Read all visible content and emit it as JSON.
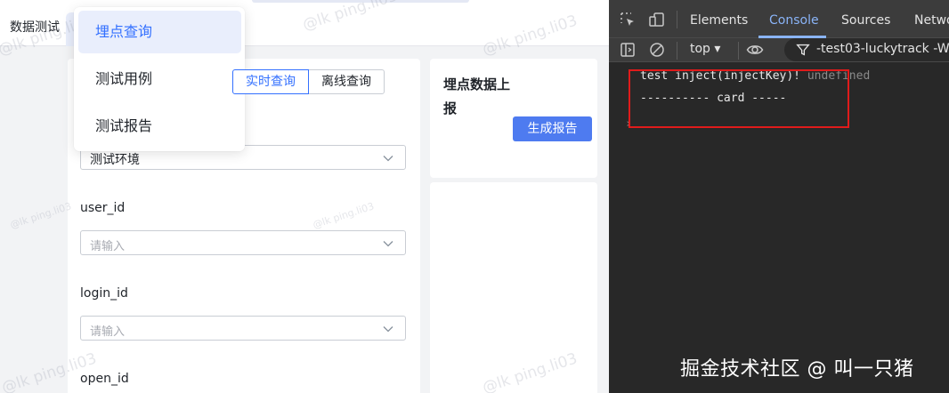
{
  "app": {
    "title": "数据测试",
    "nav_menu": {
      "items": [
        {
          "label": "埋点查询",
          "active": true
        },
        {
          "label": "测试用例",
          "active": false
        },
        {
          "label": "测试报告",
          "active": false
        }
      ]
    },
    "query_mode": {
      "options": [
        "实时查询",
        "离线查询"
      ],
      "selected": "实时查询"
    },
    "form": {
      "env_select": {
        "value": "测试环境"
      },
      "fields": [
        {
          "label": "user_id",
          "placeholder": "请输入"
        },
        {
          "label": "login_id",
          "placeholder": "请输入"
        },
        {
          "label": "open_id"
        }
      ]
    },
    "report_card": {
      "title": "埋点数据上报",
      "button_label": "生成报告"
    },
    "watermark_text": "@lk ping.li03",
    "accent_color": "#3370ff"
  },
  "devtools": {
    "tabs": [
      "Elements",
      "Console",
      "Sources",
      "Netwo"
    ],
    "active_tab": "Console",
    "toolbar": {
      "context": "top ▾",
      "filter_text": "-test03-luckytrack -W"
    },
    "console_lines": [
      {
        "text": "test inject(injectKey)!",
        "suffix": "undefined"
      },
      {
        "text": "---------- card -----",
        "suffix": ""
      }
    ],
    "prompt": "›",
    "highlight_color": "#e01b1b"
  },
  "overlay": {
    "credit": "掘金技术社区 @ 叫一只猪"
  }
}
